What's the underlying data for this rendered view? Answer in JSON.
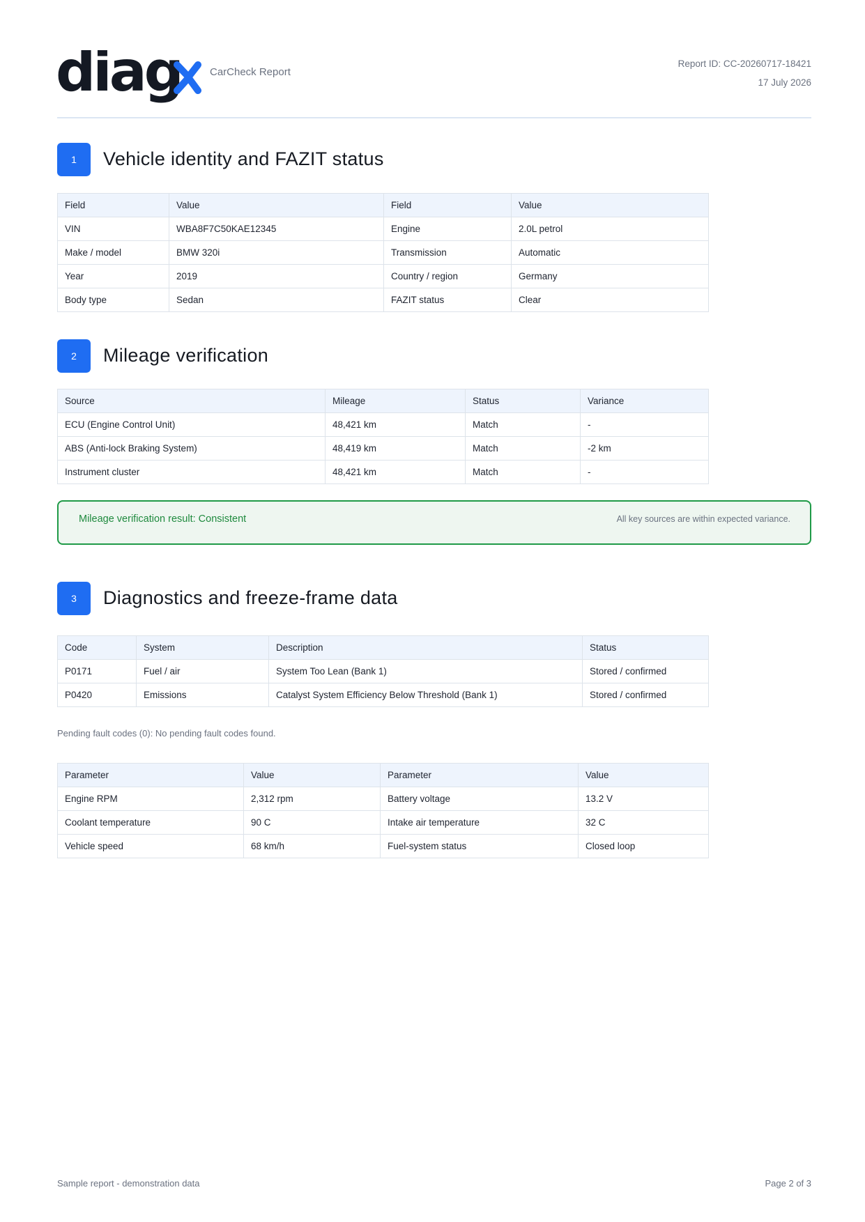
{
  "header": {
    "logo_text": "diagx",
    "subtitle": "CarCheck Report",
    "report_id": "Report ID: CC-20260717-18421",
    "date": "17 July 2026",
    "brand_color": "#1f6df2"
  },
  "sections": [
    {
      "number": "1",
      "title": "Vehicle identity and FAZIT status"
    },
    {
      "number": "2",
      "title": "Mileage verification"
    },
    {
      "number": "3",
      "title": "Diagnostics and freeze-frame data"
    }
  ],
  "vehicle_table": {
    "headers": [
      "Field",
      "Value",
      "Field",
      "Value"
    ],
    "rows": [
      [
        "VIN",
        "WBA8F7C50KAE12345",
        "Engine",
        "2.0L petrol"
      ],
      [
        "Make / model",
        "BMW 320i",
        "Transmission",
        "Automatic"
      ],
      [
        "Year",
        "2019",
        "Country / region",
        "Germany"
      ],
      [
        "Body type",
        "Sedan",
        "FAZIT status",
        "Clear"
      ]
    ]
  },
  "mileage_table": {
    "headers": [
      "Source",
      "Mileage",
      "Status",
      "Variance"
    ],
    "rows": [
      [
        "ECU (Engine Control Unit)",
        "48,421 km",
        "Match",
        "-"
      ],
      [
        "ABS (Anti-lock Braking System)",
        "48,419 km",
        "Match",
        "-2 km"
      ],
      [
        "Instrument cluster",
        "48,421 km",
        "Match",
        "-"
      ]
    ]
  },
  "mileage_result": {
    "label": "Mileage verification result: Consistent",
    "note": "All key sources are within expected variance.",
    "status_color": "#1f9a47"
  },
  "fault_table": {
    "headers": [
      "Code",
      "System",
      "Description",
      "Status"
    ],
    "rows": [
      [
        "P0171",
        "Fuel / air",
        "System Too Lean (Bank 1)",
        "Stored / confirmed"
      ],
      [
        "P0420",
        "Emissions",
        "Catalyst System Efficiency Below Threshold (Bank 1)",
        "Stored / confirmed"
      ]
    ]
  },
  "pending_note": "Pending fault codes (0): No pending fault codes found.",
  "freeze_table": {
    "headers": [
      "Parameter",
      "Value",
      "Parameter",
      "Value"
    ],
    "rows": [
      [
        "Engine RPM",
        "2,312 rpm",
        "Battery voltage",
        "13.2 V"
      ],
      [
        "Coolant temperature",
        "90 C",
        "Intake air temperature",
        "32 C"
      ],
      [
        "Vehicle speed",
        "68 km/h",
        "Fuel-system status",
        "Closed loop"
      ]
    ]
  },
  "footer": {
    "left": "Sample report - demonstration data",
    "right": "Page 2 of 3"
  }
}
